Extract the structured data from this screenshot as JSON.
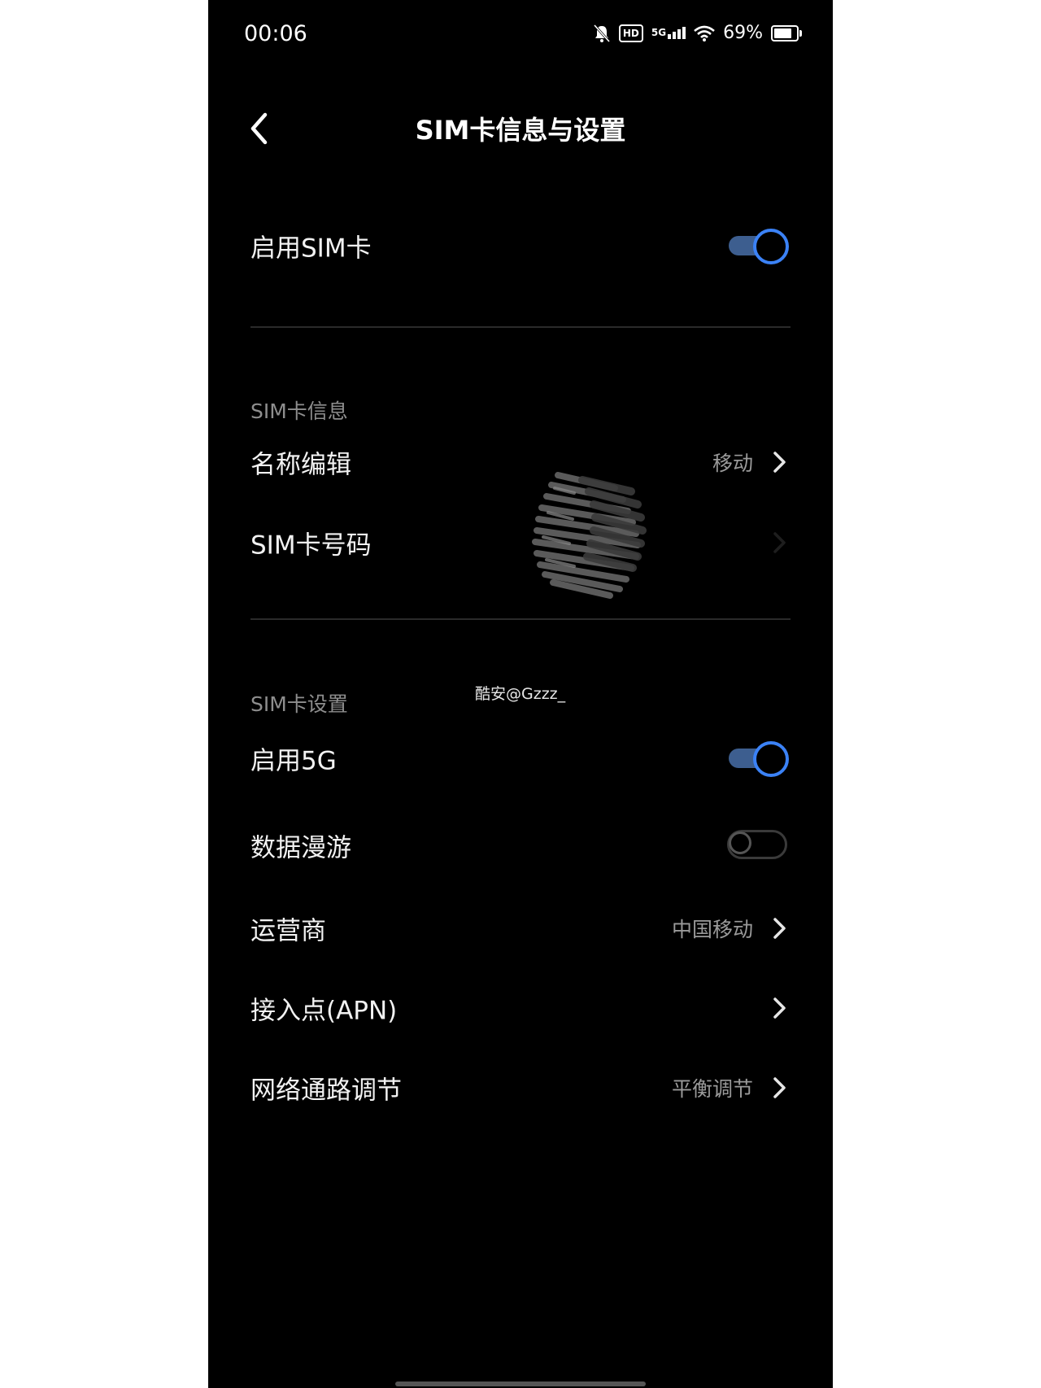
{
  "status_bar": {
    "time": "00:06",
    "network": "5G",
    "hd": "HD",
    "battery": "69%",
    "battery_level": 0.69
  },
  "header": {
    "title": "SIM卡信息与设置",
    "back_icon": "chevron-left-icon"
  },
  "enable_sim": {
    "label": "启用SIM卡",
    "enabled": true
  },
  "sim_info": {
    "section_label": "SIM卡信息",
    "name_edit": {
      "label": "名称编辑",
      "value": "移动"
    },
    "sim_number": {
      "label": "SIM卡号码"
    }
  },
  "watermark": "酷安@Gzzz_",
  "sim_settings": {
    "section_label": "SIM卡设置",
    "enable_5g": {
      "label": "启用5G",
      "enabled": true
    },
    "data_roaming": {
      "label": "数据漫游",
      "enabled": false
    },
    "carrier": {
      "label": "运营商",
      "value": "中国移动"
    },
    "apn": {
      "label": "接入点(APN)"
    },
    "network_path": {
      "label": "网络通路调节",
      "value": "平衡调节"
    }
  },
  "colors": {
    "background": "#000000",
    "accent": "#3b82f6",
    "toggle_track_on": "#3d5e8f"
  }
}
